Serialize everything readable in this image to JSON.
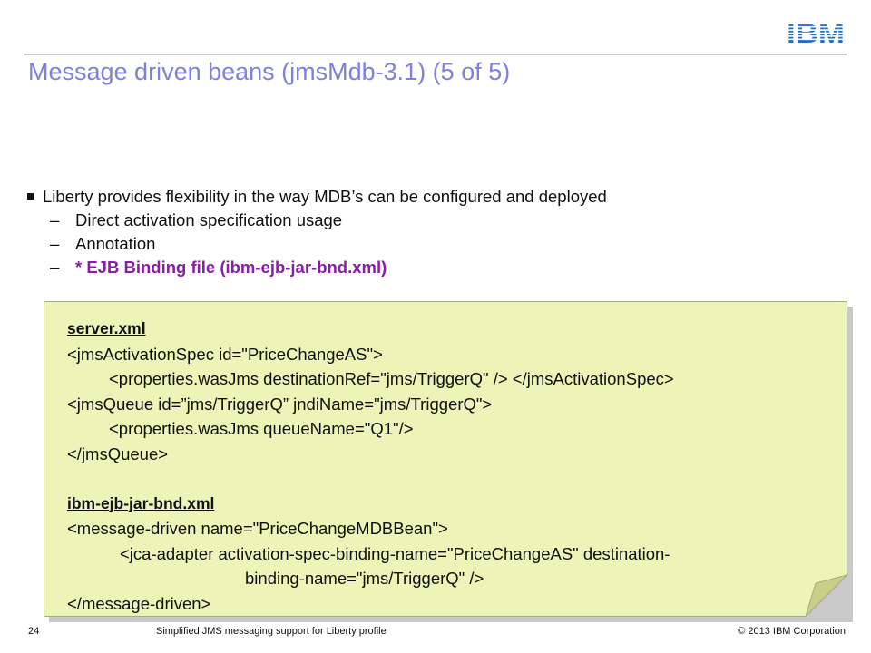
{
  "header": {
    "logo_text": "IBM",
    "title": "Message driven beans (jmsMdb-3.1) (5 of 5)"
  },
  "bullets": {
    "main": "Liberty provides flexibility in the way MDB’s can be configured and deployed",
    "dash": "–",
    "subs": [
      "Direct activation specification usage",
      "Annotation",
      "* EJB Binding file  (ibm-ejb-jar-bnd.xml)"
    ]
  },
  "note": {
    "lines": [
      "server.xml",
      "<jmsActivationSpec id=\"PriceChangeAS\">",
      "<properties.wasJms destinationRef=\"jms/TriggerQ\" /> </jmsActivationSpec>",
      "<jmsQueue id=”jms/TriggerQ” jndiName=\"jms/TriggerQ\">",
      "<properties.wasJms queueName=\"Q1\"/>",
      "</jmsQueue>",
      "",
      "ibm-ejb-jar-bnd.xml",
      "<message-driven name=\"PriceChangeMDBBean\">",
      "<jca-adapter activation-spec-binding-name=\"PriceChangeAS\" destination-",
      "binding-name=\"jms/TriggerQ\" />",
      "</message-driven>"
    ]
  },
  "footer": {
    "page_number": "24",
    "course_title": "Simplified JMS messaging support for Liberty profile",
    "copyright": "© 2013 IBM Corporation"
  },
  "colors": {
    "title": "#8080e0",
    "highlight": "#8a1ea8",
    "note_fill": "#ecf4b8",
    "note_border": "#a8ac78",
    "ibm_blue": "#1f70c1"
  }
}
